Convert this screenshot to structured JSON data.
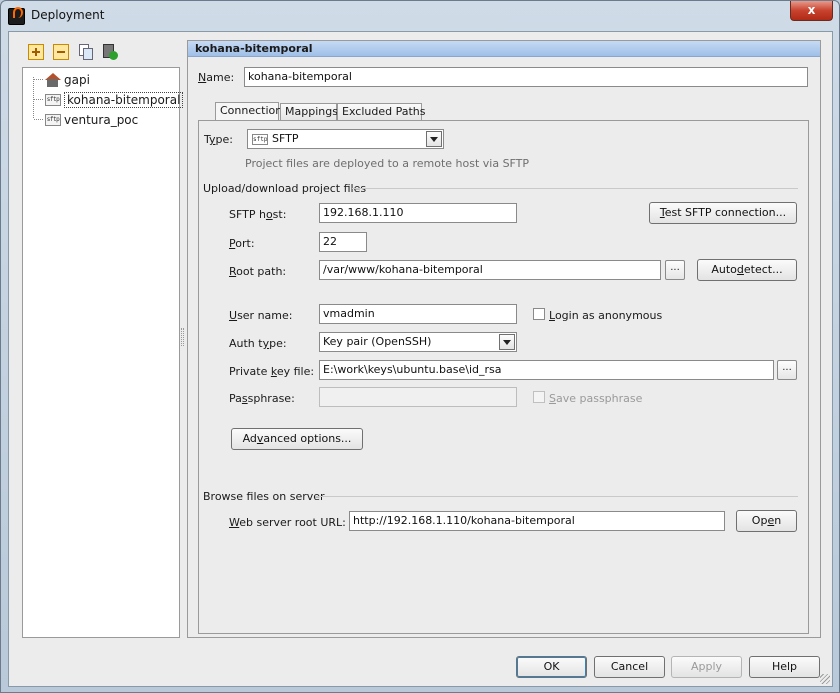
{
  "window": {
    "title": "Deployment",
    "close_label": "x"
  },
  "tree": {
    "items": [
      {
        "label": "gapi",
        "icon": "house-icon"
      },
      {
        "label": "kohana-bitemporal",
        "icon": "sftp-icon"
      },
      {
        "label": "ventura_poc",
        "icon": "sftp-icon"
      }
    ],
    "sftp_icon_text": "sftp"
  },
  "panel": {
    "header": "kohana-bitemporal"
  },
  "name": {
    "label_u": "N",
    "label_rest": "ame:",
    "value": "kohana-bitemporal"
  },
  "tabs": [
    "Connection",
    "Mappings",
    "Excluded Paths"
  ],
  "type": {
    "label_pre": "T",
    "label_u": "y",
    "label_rest": "pe:",
    "value": "SFTP",
    "hint": "Project files are deployed to a remote host via SFTP"
  },
  "upload_section": "Upload/download project files",
  "sftp_host": {
    "label_pre": "SFTP h",
    "label_u": "o",
    "label_rest": "st:",
    "value": "192.168.1.110",
    "test_btn_pre": "",
    "test_btn_u": "T",
    "test_btn_rest": "est SFTP connection..."
  },
  "port": {
    "label_u": "P",
    "label_rest": "ort:",
    "value": "22"
  },
  "root_path": {
    "label_u": "R",
    "label_rest": "oot path:",
    "value": "/var/www/kohana-bitemporal",
    "browse": "...",
    "autodetect_pre": "Auto",
    "autodetect_u": "d",
    "autodetect_rest": "etect..."
  },
  "user_name": {
    "label_u": "U",
    "label_rest": "ser name:",
    "value": "vmadmin",
    "anon_pre": "",
    "anon_u": "L",
    "anon_rest": "ogin as anonymous"
  },
  "auth_type": {
    "label_pre": "Auth t",
    "label_u": "y",
    "label_rest": "pe:",
    "value": "Key pair (OpenSSH)"
  },
  "private_key": {
    "label_pre": "Private ",
    "label_u": "k",
    "label_rest": "ey file:",
    "value": "E:\\work\\keys\\ubuntu.base\\id_rsa",
    "browse": "..."
  },
  "passphrase": {
    "label_pre": "Pa",
    "label_u": "s",
    "label_rest": "sphrase:",
    "value": "",
    "save_pre": "",
    "save_u": "S",
    "save_rest": "ave passphrase"
  },
  "advanced": {
    "pre": "Ad",
    "u": "v",
    "rest": "anced options..."
  },
  "browse_section": "Browse files on server",
  "web_root": {
    "label_u": "W",
    "label_rest": "eb server root URL:",
    "value": "http://192.168.1.110/kohana-bitemporal",
    "open_pre": "Op",
    "open_u": "e",
    "open_rest": "n"
  },
  "footer": {
    "ok": "OK",
    "cancel": "Cancel",
    "apply": "Apply",
    "help": "Help"
  }
}
